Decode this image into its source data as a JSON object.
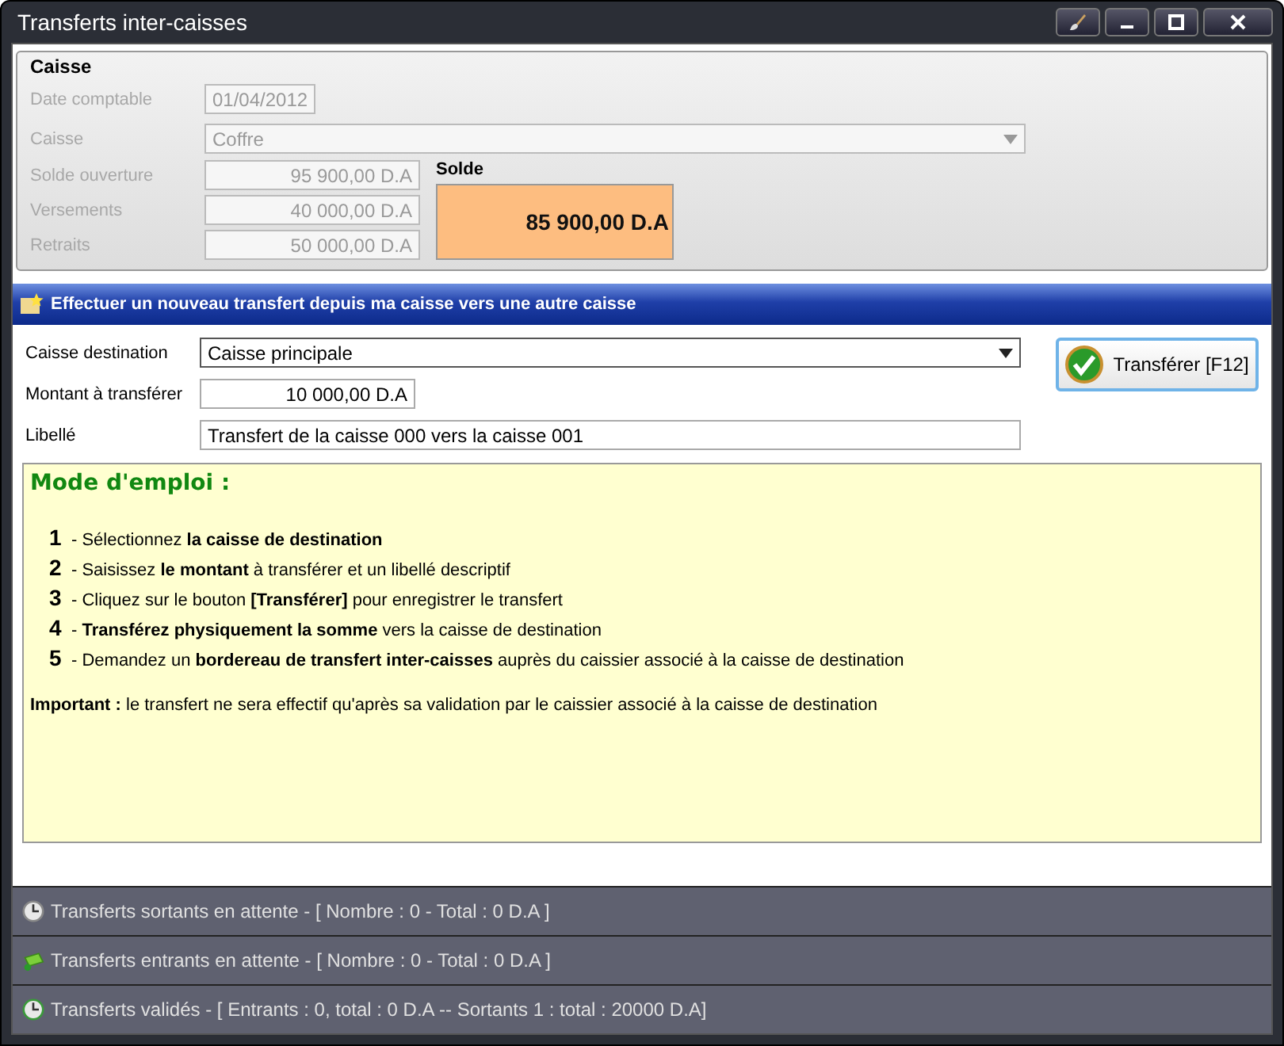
{
  "window": {
    "title": "Transferts inter-caisses"
  },
  "caisse": {
    "title": "Caisse",
    "disabled": true,
    "date": {
      "label": "Date comptable",
      "value": "01/04/2012"
    },
    "caisse": {
      "label": "Caisse",
      "value": "Coffre"
    },
    "amounts": [
      {
        "label": "Solde ouverture",
        "value": "95 900,00 D.A"
      },
      {
        "label": "Versements",
        "value": "40 000,00 D.A"
      },
      {
        "label": "Retraits",
        "value": "50 000,00 D.A"
      }
    ],
    "solde": {
      "label": "Solde",
      "value": "85 900,00 D.A"
    }
  },
  "transfer": {
    "header": "Effectuer un nouveau transfert depuis ma caisse vers une autre caisse",
    "destination": {
      "label": "Caisse destination",
      "value": "Caisse principale"
    },
    "amount": {
      "label": "Montant à transférer",
      "value": "10 000,00 D.A"
    },
    "description": {
      "label": "Libellé",
      "value": "Transfert de la caisse 000 vers la caisse 001"
    },
    "button": "Transférer [F12]"
  },
  "instructions": {
    "title": "Mode d'emploi :",
    "steps": [
      {
        "number": "1",
        "text": "- Sélectionnez **la caisse de destination**"
      },
      {
        "number": "2",
        "text": "- Saisissez **le montant** à transférer et un libellé descriptif"
      },
      {
        "number": "3",
        "text": "- Cliquez sur le bouton **[Transférer]** pour enregistrer le transfert"
      },
      {
        "number": "4",
        "text": "- **Transférez physiquement la somme** vers la caisse de destination"
      },
      {
        "number": "5",
        "text": "- Demandez un **bordereau de transfert inter-caisses** auprès du caissier associé à la caisse de destination"
      }
    ],
    "note": "**Important :** le transfert ne sera effectif qu'après sa validation par le caissier associé à la caisse de destination"
  },
  "panels": [
    {
      "kind": "outgoing",
      "label": "Transferts sortants en attente - [ Nombre : 0 - Total : 0 D.A ]"
    },
    {
      "kind": "incoming",
      "label": "Transferts entrants en attente - [ Nombre : 0 - Total : 0 D.A ]"
    },
    {
      "kind": "validated",
      "label": "Transferts validés - [ Entrants : 0,  total : 0 D.A -- Sortants 1 : total : 20000 D.A]"
    }
  ]
}
